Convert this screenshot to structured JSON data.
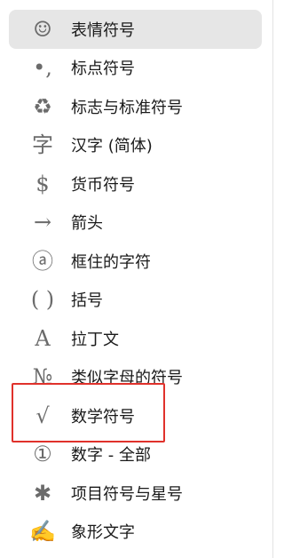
{
  "categories": [
    {
      "label": "表情符号",
      "icon": "smiley-icon",
      "glyph": "☺",
      "selected": true
    },
    {
      "label": "标点符号",
      "icon": "punctuation-icon",
      "glyph": "•,",
      "selected": false
    },
    {
      "label": "标志与标准符号",
      "icon": "recycle-icon",
      "glyph": "♻",
      "selected": false
    },
    {
      "label": "汉字 (简体)",
      "icon": "hanzi-icon",
      "glyph": "字",
      "selected": false
    },
    {
      "label": "货币符号",
      "icon": "dollar-icon",
      "glyph": "$",
      "selected": false
    },
    {
      "label": "箭头",
      "icon": "arrow-right-icon",
      "glyph": "→",
      "selected": false
    },
    {
      "label": "框住的字符",
      "icon": "circled-a-icon",
      "glyph": "ⓐ",
      "selected": false
    },
    {
      "label": "括号",
      "icon": "parentheses-icon",
      "glyph": "( )",
      "selected": false
    },
    {
      "label": "拉丁文",
      "icon": "latin-a-icon",
      "glyph": "A",
      "selected": false
    },
    {
      "label": "类似字母的符号",
      "icon": "numero-icon",
      "glyph": "№",
      "selected": false
    },
    {
      "label": "数学符号",
      "icon": "square-root-icon",
      "glyph": "√",
      "selected": false
    },
    {
      "label": "数字 - 全部",
      "icon": "circled-one-icon",
      "glyph": "①",
      "selected": false
    },
    {
      "label": "项目符号与星号",
      "icon": "asterisk-icon",
      "glyph": "✱",
      "selected": false
    },
    {
      "label": "象形文字",
      "icon": "pictograph-icon",
      "glyph": "✍",
      "selected": false
    }
  ],
  "colors": {
    "selected_background": "#e6e6e6",
    "highlight_border": "#e0312b",
    "icon": "#6b6b6b",
    "text": "#1a1a1a"
  }
}
